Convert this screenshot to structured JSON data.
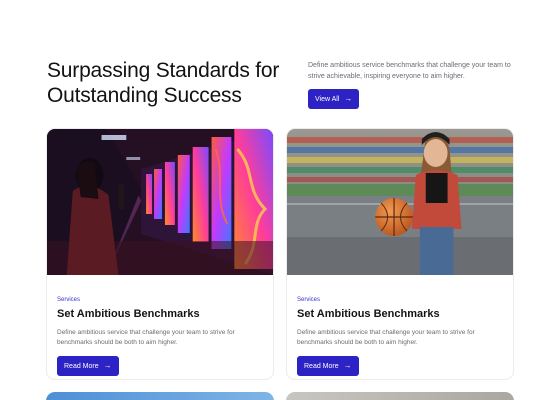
{
  "hero": {
    "title": "Surpassing Standards for Outstanding Success",
    "description": "Define ambitious service benchmarks that challenge your team to strive achievable, inspiring everyone to aim higher.",
    "button_label": "View All"
  },
  "cards": [
    {
      "image_icon": "gallery-photo",
      "tag": "Services",
      "title": "Set Ambitious Benchmarks",
      "description": "Define ambitious service that challenge your team to strive for benchmarks should be both to aim higher.",
      "button_label": "Read More"
    },
    {
      "image_icon": "basketball-portrait-photo",
      "tag": "Services",
      "title": "Set Ambitious Benchmarks",
      "description": "Define ambitious service that challenge your team to strive for benchmarks should be both to aim higher.",
      "button_label": "Read More"
    }
  ],
  "colors": {
    "accent": "#2d22c4",
    "tag": "#3a34c8",
    "muted_text": "#6b6b75"
  },
  "icons": {
    "button_arrow": "arrow-right-icon"
  }
}
